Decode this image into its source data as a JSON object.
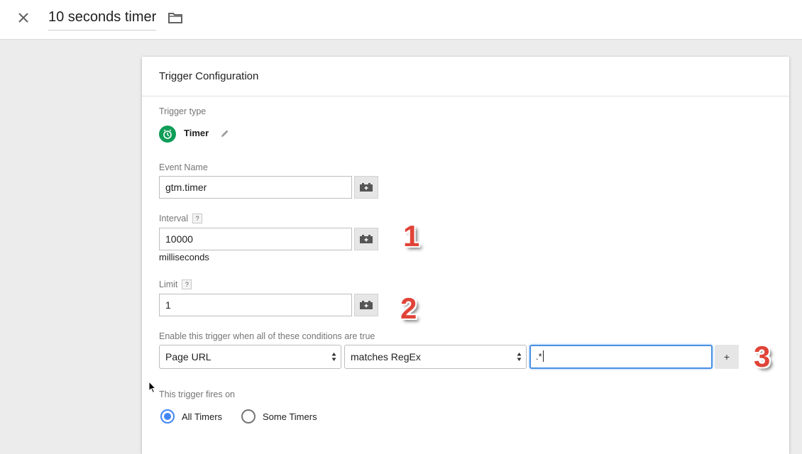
{
  "header": {
    "title": "10 seconds timer",
    "close_icon": "close-icon",
    "folder_icon": "folder-icon"
  },
  "card": {
    "title": "Trigger Configuration",
    "trigger_type_label": "Trigger type",
    "trigger_type": {
      "name": "Timer",
      "icon": "timer-icon",
      "icon_color": "#0f9d58",
      "edit_icon": "pencil-icon"
    },
    "event_name": {
      "label": "Event Name",
      "value": "gtm.timer"
    },
    "interval": {
      "label": "Interval",
      "help": "?",
      "value": "10000",
      "unit": "milliseconds"
    },
    "limit": {
      "label": "Limit",
      "help": "?",
      "value": "1"
    },
    "conditions": {
      "label": "Enable this trigger when all of these conditions are true",
      "variable": "Page URL",
      "operator": "matches RegEx",
      "value": ".*",
      "add_label": "+"
    },
    "fires_on": {
      "label": "This trigger fires on",
      "options": [
        {
          "label": "All Timers",
          "checked": true
        },
        {
          "label": "Some Timers",
          "checked": false
        }
      ]
    }
  },
  "annotations": [
    "1",
    "2",
    "3"
  ],
  "colors": {
    "accent": "#4285f4",
    "annotation": "#e04438",
    "focus_border": "#4a90e2"
  }
}
